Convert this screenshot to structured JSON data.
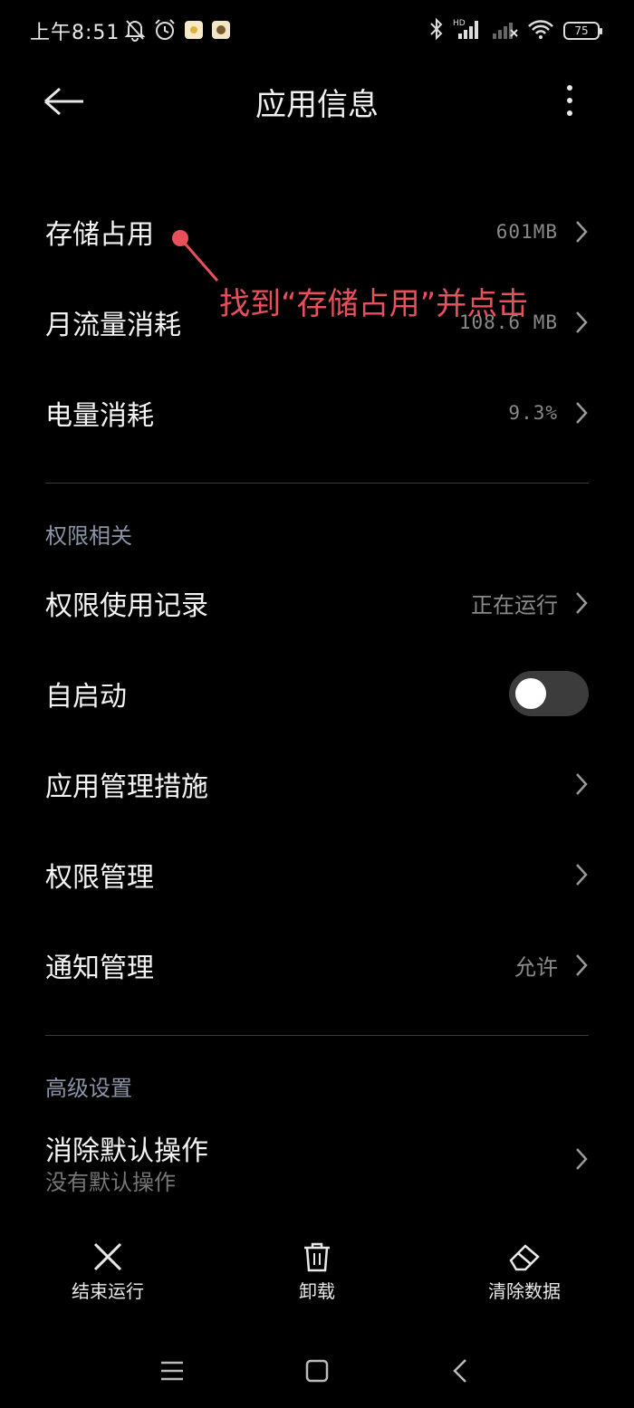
{
  "status_bar": {
    "time": "上午8:51",
    "icons": [
      "mute-bell-icon",
      "alarm-icon",
      "app-notification-icon",
      "app-notification-icon-2",
      "bluetooth-icon",
      "hd-signal-icon",
      "signal-no-service-icon",
      "wifi-icon"
    ],
    "battery_level": "75"
  },
  "app_bar": {
    "title": "应用信息",
    "back_icon": "arrow-left-icon",
    "more_icon": "more-vert-icon"
  },
  "usage": {
    "storage": {
      "label": "存储占用",
      "value": "601MB"
    },
    "data": {
      "label": "月流量消耗",
      "value": "108.6 MB"
    },
    "battery": {
      "label": "电量消耗",
      "value": "9.3%"
    }
  },
  "permissions_section": {
    "header": "权限相关",
    "usage_record": {
      "label": "权限使用记录",
      "value": "正在运行"
    },
    "autostart": {
      "label": "自启动",
      "enabled": false
    },
    "app_management": {
      "label": "应用管理措施"
    },
    "permission_management": {
      "label": "权限管理"
    },
    "notification_management": {
      "label": "通知管理",
      "value": "允许"
    }
  },
  "advanced_section": {
    "header": "高级设置",
    "clear_defaults": {
      "label": "消除默认操作",
      "sub": "没有默认操作"
    }
  },
  "annotation": {
    "text": "找到“存储占用”并点击",
    "color": "#e8505b"
  },
  "bottom_actions": [
    {
      "label": "结束运行",
      "icon": "close-icon"
    },
    {
      "label": "卸载",
      "icon": "trash-icon"
    },
    {
      "label": "清除数据",
      "icon": "eraser-icon"
    }
  ],
  "nav_bar": {
    "icons": [
      "menu-icon",
      "home-icon",
      "back-icon"
    ]
  }
}
